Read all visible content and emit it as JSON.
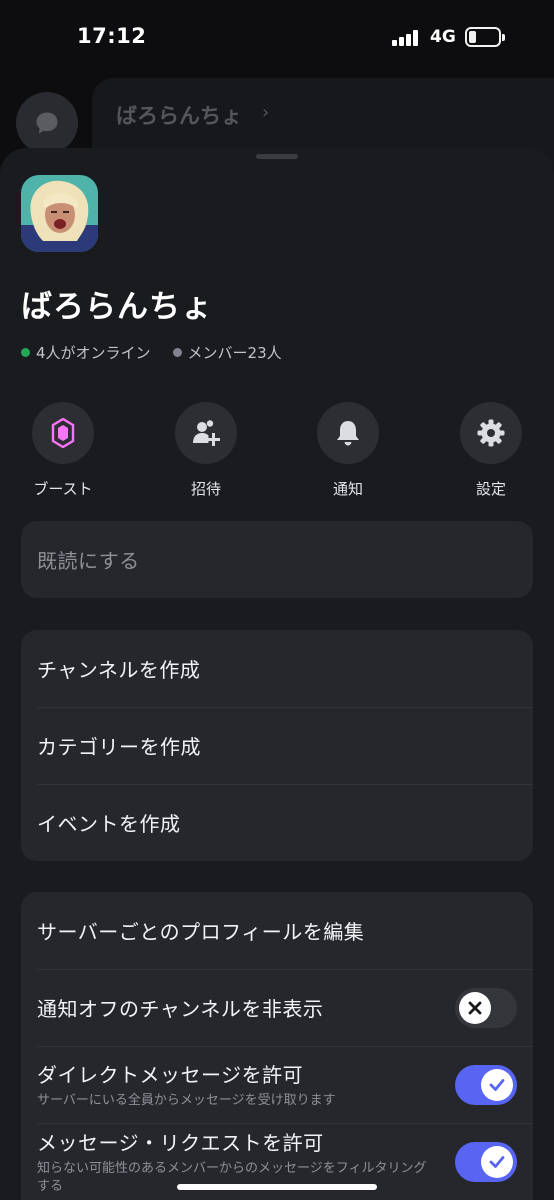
{
  "status_bar": {
    "time": "17:12",
    "network": "4G",
    "battery_level": 0.25,
    "icons": [
      "signal-icon",
      "battery-icon"
    ]
  },
  "background": {
    "server_name": "ばろらんちょ",
    "chevron": "›",
    "icons": [
      "chat-bubble-icon"
    ]
  },
  "server": {
    "name": "ばろらんちょ",
    "online_text": "4人がオンライン",
    "members_text": "メンバー23人",
    "online_color": "#23a55a",
    "member_color": "#80848e"
  },
  "actions": [
    {
      "label": "ブースト",
      "icon": "boost-icon"
    },
    {
      "label": "招待",
      "icon": "add-user-icon"
    },
    {
      "label": "通知",
      "icon": "bell-icon"
    },
    {
      "label": "設定",
      "icon": "gear-icon"
    }
  ],
  "mark_read": {
    "label": "既読にする"
  },
  "create_menu": [
    {
      "label": "チャンネルを作成"
    },
    {
      "label": "カテゴリーを作成"
    },
    {
      "label": "イベントを作成"
    }
  ],
  "settings_menu": {
    "edit_profile": "サーバーごとのプロフィールを編集",
    "hide_muted": {
      "label": "通知オフのチャンネルを非表示",
      "enabled": false
    },
    "allow_dm": {
      "label": "ダイレクトメッセージを許可",
      "sub": "サーバーにいる全員からメッセージを受け取ります",
      "enabled": true
    },
    "allow_requests": {
      "label": "メッセージ・リクエストを許可",
      "sub": "知らない可能性のあるメンバーからのメッセージをフィルタリングする",
      "enabled": true
    }
  },
  "colors": {
    "accent": "#5865f2",
    "sheet": "#1a1b1f",
    "card": "#26272d",
    "boost": "#ff73fa"
  }
}
